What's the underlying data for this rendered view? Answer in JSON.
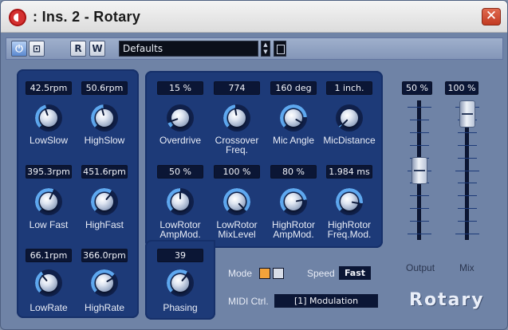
{
  "window": {
    "title": ": Ins. 2 - Rotary",
    "close_glyph": "✕"
  },
  "toolbar": {
    "power_glyph": "⏻",
    "bypass_glyph": "⊡",
    "read_label": "R",
    "write_label": "W",
    "preset_value": "Defaults",
    "arrows_glyph": "▲▼"
  },
  "left_panel": {
    "values": [
      "42.5rpm",
      "50.6rpm",
      "395.3rpm",
      "451.6rpm",
      "66.1rpm",
      "366.0rpm"
    ],
    "labels": [
      "LowSlow",
      "HighSlow",
      "Low Fast",
      "HighFast",
      "LowRate",
      "HighRate"
    ]
  },
  "mid_panel": {
    "values_row1": [
      "15 %",
      "774",
      "160 deg",
      "1 inch."
    ],
    "labels_row1": [
      "Overdrive",
      "Crossover",
      "Freq.",
      "Mic Angle",
      "MicDistance"
    ],
    "values_row2": [
      "50 %",
      "100 %",
      "80 %",
      "1.984 ms"
    ],
    "labels_row2": [
      "LowRotor",
      "AmpMod.",
      "LowRotor",
      "MixLevel",
      "HighRotor",
      "AmpMod.",
      "HighRotor",
      "Freq.Mod."
    ]
  },
  "phasing": {
    "value": "39",
    "label": "Phasing"
  },
  "faders": {
    "output_value": "50 %",
    "mix_value": "100 %",
    "output_label": "Output",
    "mix_label": "Mix",
    "output_level": 0.5,
    "mix_level": 1.0
  },
  "controls": {
    "mode_label": "Mode",
    "speed_label": "Speed",
    "speed_value": "Fast",
    "midi_label": "MIDI Ctrl.",
    "midi_value": "[1] Modulation"
  },
  "brand": {
    "logo_text": "Rotary"
  },
  "colors": {
    "accent": "#f2a23a",
    "panel": "#1d3a78",
    "knob_arc": "#5ea8f0"
  }
}
